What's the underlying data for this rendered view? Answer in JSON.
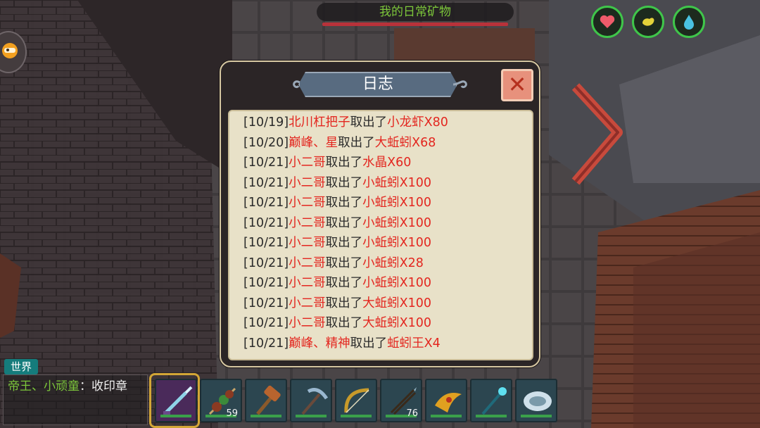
{
  "chest_title": "我的日常矿物",
  "dialog": {
    "title": "日志",
    "close_label": "✕",
    "entries": [
      {
        "date": "[10/19]",
        "player": "北川杠把子",
        "action": "取出了",
        "item": "小龙虾X80"
      },
      {
        "date": "[10/20]",
        "player": "巅峰、星",
        "action": "取出了",
        "item": "大蚯蚓X68"
      },
      {
        "date": "[10/21]",
        "player": "小二哥",
        "action": "取出了",
        "item": "水晶X60"
      },
      {
        "date": "[10/21]",
        "player": "小二哥",
        "action": "取出了",
        "item": "小蚯蚓X100"
      },
      {
        "date": "[10/21]",
        "player": "小二哥",
        "action": "取出了",
        "item": "小蚯蚓X100"
      },
      {
        "date": "[10/21]",
        "player": "小二哥",
        "action": "取出了",
        "item": "小蚯蚓X100"
      },
      {
        "date": "[10/21]",
        "player": "小二哥",
        "action": "取出了",
        "item": "小蚯蚓X100"
      },
      {
        "date": "[10/21]",
        "player": "小二哥",
        "action": "取出了",
        "item": "小蚯蚓X28"
      },
      {
        "date": "[10/21]",
        "player": "小二哥",
        "action": "取出了",
        "item": "小蚯蚓X100"
      },
      {
        "date": "[10/21]",
        "player": "小二哥",
        "action": "取出了",
        "item": "大蚯蚓X100"
      },
      {
        "date": "[10/21]",
        "player": "小二哥",
        "action": "取出了",
        "item": "大蚯蚓X100"
      },
      {
        "date": "[10/21]",
        "player": "巅峰、精神",
        "action": "取出了",
        "item": "蚯蚓王X4"
      }
    ]
  },
  "chat": {
    "channel": "世界",
    "speaker": "帝王、小顽童",
    "separator": "：",
    "message": "收印章"
  },
  "status_icons": [
    "heart-icon",
    "stomach-icon",
    "water-drop-icon"
  ],
  "hotbar": [
    {
      "icon": "crystal-sword-icon",
      "count": "",
      "selected": true
    },
    {
      "icon": "meat-skewer-icon",
      "count": "59",
      "selected": false
    },
    {
      "icon": "hammer-icon",
      "count": "",
      "selected": false
    },
    {
      "icon": "pickaxe-icon",
      "count": "",
      "selected": false
    },
    {
      "icon": "bow-icon",
      "count": "",
      "selected": false
    },
    {
      "icon": "arrow-bundle-icon",
      "count": "76",
      "selected": false
    },
    {
      "icon": "horn-icon",
      "count": "",
      "selected": false
    },
    {
      "icon": "magic-staff-icon",
      "count": "",
      "selected": false
    },
    {
      "icon": "shield-disc-icon",
      "count": "",
      "selected": false
    }
  ],
  "colors": {
    "accent_green": "#3fc64a",
    "log_highlight_red": "#e3261f",
    "close_button": "#e7917c",
    "dialog_header": "#586b80"
  }
}
